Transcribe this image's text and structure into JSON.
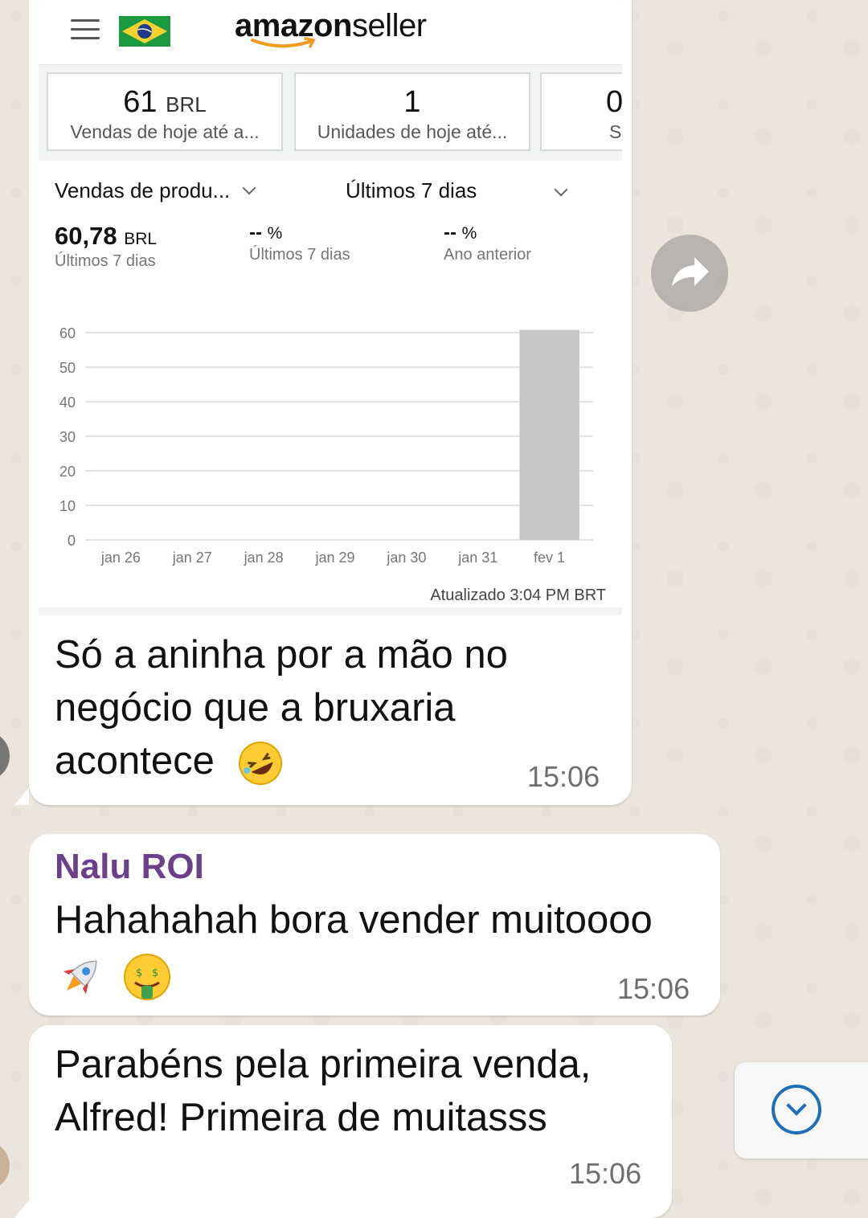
{
  "chat": {
    "message1": {
      "screenshot": {
        "app": {
          "logo_primary": "amazon",
          "logo_secondary": "seller",
          "flag_country": "Brazil",
          "menu_icon": "hamburger-icon"
        },
        "kpi_cards": [
          {
            "value": "61",
            "unit": "BRL",
            "label": "Vendas de hoje até a..."
          },
          {
            "value": "1",
            "unit": "",
            "label": "Unidades de hoje até..."
          },
          {
            "value": "0",
            "unit": "",
            "label": "S"
          }
        ],
        "filters": {
          "metric_dropdown": "Vendas de produ...",
          "period_dropdown": "Últimos 7 dias"
        },
        "metrics": [
          {
            "value": "60,78",
            "unit": "BRL",
            "label": "Últimos 7 dias"
          },
          {
            "value": "--",
            "unit": "%",
            "label": "Últimos 7 dias"
          },
          {
            "value": "--",
            "unit": "%",
            "label": "Ano anterior"
          }
        ],
        "updated_text": "Atualizado 3:04 PM BRT"
      },
      "text_lines": [
        "Só a aninha por a mão no",
        "negócio que a bruxaria",
        "acontece"
      ],
      "emoji": "rolling-on-floor-laughing-emoji",
      "time": "15:06"
    },
    "message2": {
      "sender": "Nalu ROI",
      "text": "Hahahahah bora vender muitoooo",
      "emojis": [
        "rocket-emoji",
        "money-mouth-emoji"
      ],
      "time": "15:06",
      "sender_color": "#6B3F8A"
    },
    "message3": {
      "text_lines": [
        "Parabéns pela primeira venda,",
        "Alfred! Primeira de muitasss"
      ],
      "time": "15:06"
    }
  },
  "chart_data": {
    "type": "bar",
    "categories": [
      "jan 26",
      "jan 27",
      "jan 28",
      "jan 29",
      "jan 30",
      "jan 31",
      "fev 1"
    ],
    "values": [
      0,
      0,
      0,
      0,
      0,
      0,
      60.78
    ],
    "yticks": [
      0,
      10,
      20,
      30,
      40,
      50,
      60
    ],
    "ylim": [
      0,
      60
    ],
    "grid": true,
    "bar_color": "#C8C8CA"
  }
}
